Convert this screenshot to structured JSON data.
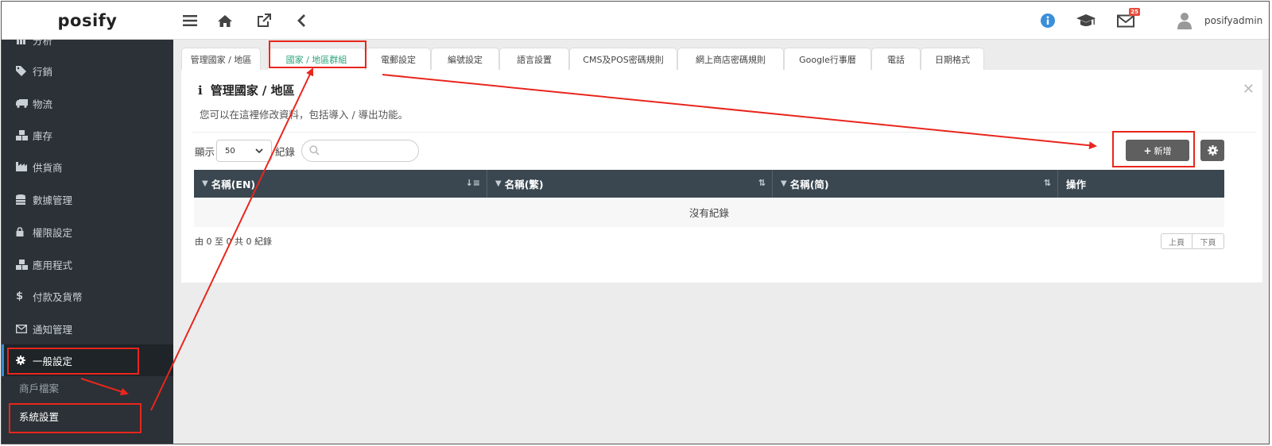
{
  "app": {
    "logo": "posify",
    "username": "posifyadmin",
    "notification_count": "25"
  },
  "sidebar": {
    "items": [
      {
        "label": "分析",
        "icon": "chart-icon"
      },
      {
        "label": "行銷",
        "icon": "tags-icon"
      },
      {
        "label": "物流",
        "icon": "truck-icon"
      },
      {
        "label": "庫存",
        "icon": "cubes-icon"
      },
      {
        "label": "供貨商",
        "icon": "industry-icon"
      },
      {
        "label": "數據管理",
        "icon": "database-icon"
      },
      {
        "label": "權限設定",
        "icon": "lock-icon"
      },
      {
        "label": "應用程式",
        "icon": "cubes-icon"
      },
      {
        "label": "付款及貨幣",
        "icon": "dollar-icon"
      },
      {
        "label": "通知管理",
        "icon": "envelope-icon"
      },
      {
        "label": "一般設定",
        "icon": "gear-icon"
      }
    ],
    "sub_items": [
      {
        "label": "商戶檔案"
      },
      {
        "label": "系統設置"
      }
    ]
  },
  "tabs": [
    {
      "label": "管理國家 / 地區"
    },
    {
      "label": "國家 / 地區群組"
    },
    {
      "label": "電郵設定"
    },
    {
      "label": "編號設定"
    },
    {
      "label": "語言設置"
    },
    {
      "label": "CMS及POS密碼規則"
    },
    {
      "label": "網上商店密碼規則"
    },
    {
      "label": "Google行事曆"
    },
    {
      "label": "電話"
    },
    {
      "label": "日期格式"
    }
  ],
  "panel": {
    "title": "管理國家 / 地區",
    "description": "您可以在這裡修改資料，包括導入 / 導出功能。",
    "length_label_before": "顯示",
    "length_value": "50",
    "length_label_after": "紀錄",
    "add_button": "新增",
    "columns": [
      "名稱(EN)",
      "名稱(繁)",
      "名稱(简)",
      "操作"
    ],
    "empty_text": "沒有紀錄",
    "info_text": "由 0 至 0 共 0 紀錄",
    "prev_label": "上頁",
    "next_label": "下頁"
  },
  "colors": {
    "sidebar_bg": "#2b3136",
    "table_header": "#3a4750",
    "active_tab": "#2ba37b",
    "annotation": "#e8261d",
    "add_button": "#5f5f5f"
  }
}
